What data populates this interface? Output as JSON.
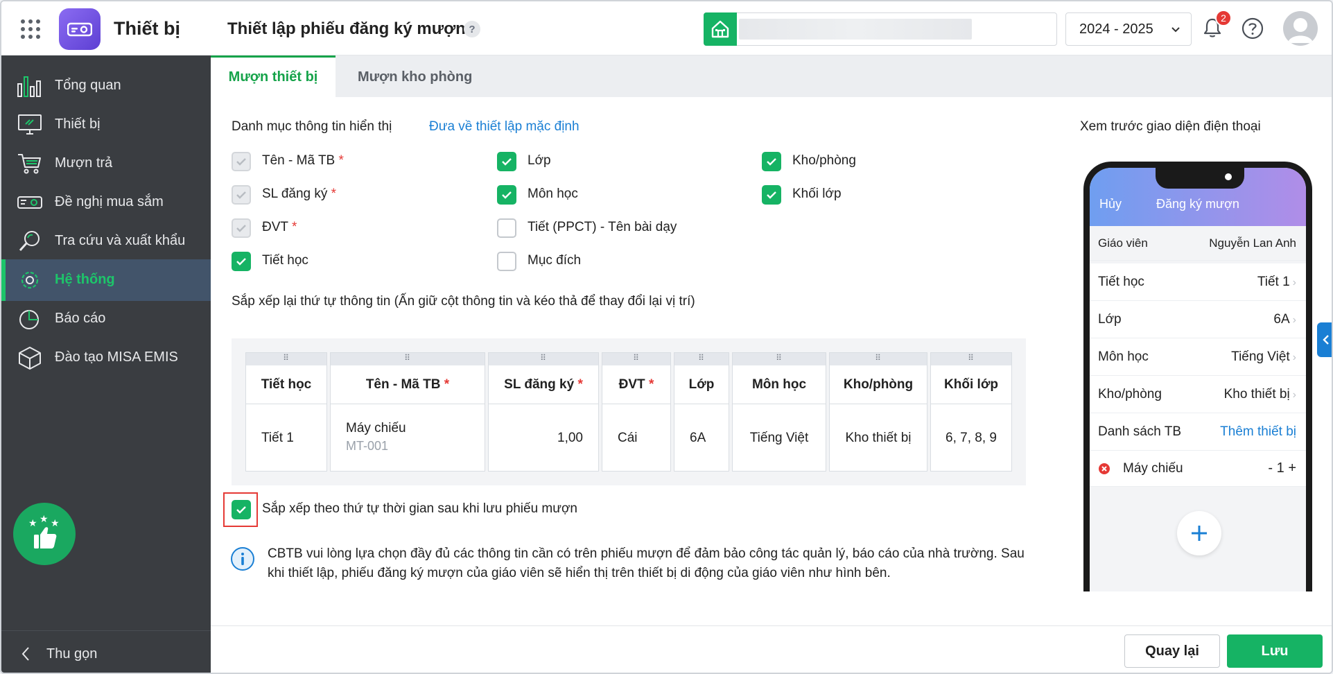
{
  "header": {
    "app_name": "Thiết bị",
    "page_title": "Thiết lập phiếu đăng ký mượn",
    "help_mark": "?",
    "school_year": "2024 - 2025",
    "notification_count": "2"
  },
  "sidebar": {
    "items": [
      {
        "label": "Tổng quan",
        "icon": "chart-bars-icon"
      },
      {
        "label": "Thiết bị",
        "icon": "monitor-icon"
      },
      {
        "label": "Mượn trả",
        "icon": "cart-icon"
      },
      {
        "label": "Đề nghị mua sắm",
        "icon": "projector-icon"
      },
      {
        "label": "Tra cứu và xuất khẩu",
        "icon": "search-icon"
      },
      {
        "label": "Hệ thống",
        "icon": "gear-icon"
      },
      {
        "label": "Báo cáo",
        "icon": "pie-chart-icon"
      },
      {
        "label": "Đào tạo MISA EMIS",
        "icon": "cube-icon"
      }
    ],
    "active_index": 5,
    "collapse_label": "Thu gọn"
  },
  "tabs": [
    {
      "label": "Mượn thiết bị",
      "active": true
    },
    {
      "label": "Mượn kho phòng",
      "active": false
    }
  ],
  "main": {
    "section_label": "Danh mục thông tin hiển thị",
    "reset_link": "Đưa về thiết lập mặc định",
    "fields": {
      "ten_ma_tb": {
        "label": "Tên - Mã TB",
        "req": "*"
      },
      "sl_dang_ky": {
        "label": "SL đăng ký",
        "req": "*"
      },
      "dvt": {
        "label": "ĐVT",
        "req": "*"
      },
      "tiet_hoc": {
        "label": "Tiết học"
      },
      "lop": {
        "label": "Lớp"
      },
      "mon_hoc": {
        "label": "Môn học"
      },
      "tiet_ppct": {
        "label": "Tiết (PPCT) - Tên bài dạy"
      },
      "muc_dich": {
        "label": "Mục đích"
      },
      "kho_phong": {
        "label": "Kho/phòng"
      },
      "khoi_lop": {
        "label": "Khối lớp"
      }
    },
    "sort_label": "Sắp xếp lại thứ tự thông tin (Ấn giữ cột thông tin và kéo thả để thay đổi lại vị trí)",
    "table": {
      "grip": "⠿",
      "headers": [
        "Tiết học",
        "Tên - Mã TB",
        "SL đăng ký",
        "ĐVT",
        "Lớp",
        "Môn học",
        "Kho/phòng",
        "Khối lớp"
      ],
      "req_mark": "*",
      "row": {
        "tiet_hoc": "Tiết 1",
        "ten": "Máy chiếu",
        "ma": "MT-001",
        "sl": "1,00",
        "dvt": "Cái",
        "lop": "6A",
        "mon_hoc": "Tiếng Việt",
        "kho_phong": "Kho thiết bị",
        "khoi_lop": "6, 7, 8, 9"
      }
    },
    "auto_sort_label": "Sắp xếp theo thứ tự thời gian sau khi lưu phiếu mượn",
    "info_text": "CBTB vui lòng lựa chọn đầy đủ các thông tin cần có trên phiếu mượn để đảm bảo công tác quản lý, báo cáo của nhà trường. Sau khi thiết lập, phiếu đăng ký mượn của giáo viên sẽ hiển thị trên thiết bị di động của giáo viên như hình bên."
  },
  "preview": {
    "label": "Xem trước giao diện điện thoại",
    "cancel": "Hủy",
    "title": "Đăng ký mượn",
    "teacher_label": "Giáo viên",
    "teacher_name": "Nguyễn Lan Anh",
    "rows": [
      {
        "label": "Tiết học",
        "value": "Tiết 1"
      },
      {
        "label": "Lớp",
        "value": "6A"
      },
      {
        "label": "Môn học",
        "value": "Tiếng Việt"
      },
      {
        "label": "Kho/phòng",
        "value": "Kho thiết bị"
      }
    ],
    "device_list_label": "Danh sách TB",
    "add_device": "Thêm thiết bị",
    "device_item": "Máy chiếu",
    "qty_text": "- 1 +"
  },
  "footer": {
    "back_label": "Quay lại",
    "save_label": "Lưu"
  },
  "colors": {
    "accent_green": "#16b364",
    "sidebar_bg": "#3a3d41",
    "link_blue": "#1a7fd4",
    "required_red": "#e53935"
  }
}
